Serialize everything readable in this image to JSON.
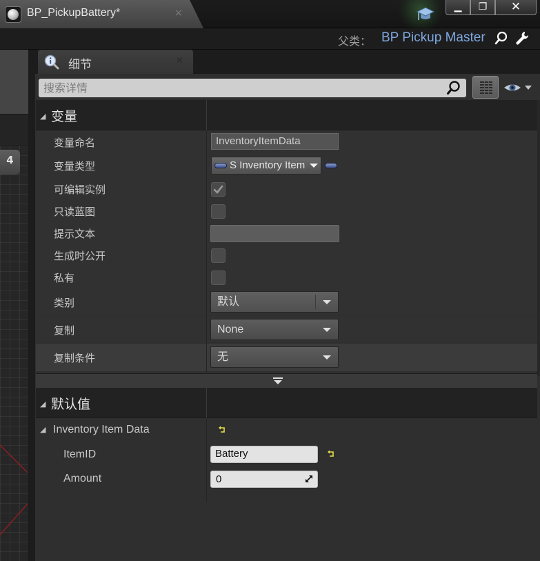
{
  "window": {
    "tab_title": "BP_PickupBattery*",
    "tab_close": "×",
    "controls": {
      "minimize": "▁",
      "maximize": "❐",
      "close": "✕"
    }
  },
  "parent_bar": {
    "label": "父类：",
    "value": "BP Pickup Master",
    "search_icon": "magnifier-icon",
    "edit_icon": "wrench-icon"
  },
  "left_panel": {
    "zoom_badge": "4"
  },
  "details_panel": {
    "tab_label": "细节",
    "tab_close": "×",
    "search": {
      "placeholder": "搜索详情",
      "value": ""
    },
    "variable_section": {
      "title": "变量",
      "rows": {
        "var_name": {
          "label": "变量命名",
          "value": "InventoryItemData"
        },
        "var_type": {
          "label": "变量类型",
          "value": "S Inventory Item"
        },
        "instance_editable": {
          "label": "可编辑实例",
          "checked": true
        },
        "blueprint_readonly": {
          "label": "只读蓝图",
          "checked": false
        },
        "tooltip": {
          "label": "提示文本",
          "value": ""
        },
        "expose_on_spawn": {
          "label": "生成时公开",
          "checked": false
        },
        "private": {
          "label": "私有",
          "checked": false
        },
        "category": {
          "label": "类别",
          "value": "默认"
        },
        "replication": {
          "label": "复制",
          "value": "None"
        },
        "replication_condition": {
          "label": "复制条件",
          "value": "无"
        }
      }
    },
    "default_section": {
      "title": "默认值",
      "struct_label": "Inventory Item Data",
      "fields": {
        "item_id": {
          "label": "ItemID",
          "value": "Battery"
        },
        "amount": {
          "label": "Amount",
          "value": "0"
        }
      }
    }
  },
  "colors": {
    "accent_blue": "#7fa8e0",
    "reset_yellow": "#e8e04a",
    "panel_bg": "#2f2f2f",
    "category_bg": "#222222"
  }
}
